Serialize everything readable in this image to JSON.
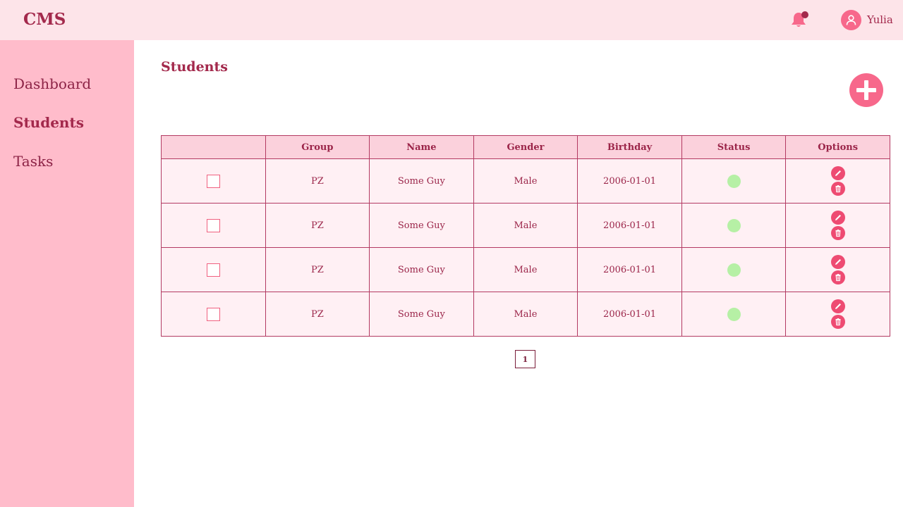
{
  "header": {
    "logo": "CMS",
    "user_name": "Yulia"
  },
  "sidebar": {
    "items": [
      {
        "label": "Dashboard",
        "active": false
      },
      {
        "label": "Students",
        "active": true
      },
      {
        "label": "Tasks",
        "active": false
      }
    ]
  },
  "main": {
    "title": "Students",
    "table": {
      "headers": [
        "",
        "Group",
        "Name",
        "Gender",
        "Birthday",
        "Status",
        "Options"
      ],
      "rows": [
        {
          "group": "PZ",
          "name": "Some Guy",
          "gender": "Male",
          "birthday": "2006-01-01",
          "status": "active"
        },
        {
          "group": "PZ",
          "name": "Some Guy",
          "gender": "Male",
          "birthday": "2006-01-01",
          "status": "active"
        },
        {
          "group": "PZ",
          "name": "Some Guy",
          "gender": "Male",
          "birthday": "2006-01-01",
          "status": "active"
        },
        {
          "group": "PZ",
          "name": "Some Guy",
          "gender": "Male",
          "birthday": "2006-01-01",
          "status": "active"
        }
      ]
    },
    "pagination": {
      "current_page": "1"
    }
  },
  "icons": {
    "notification": "bell-icon",
    "avatar": "user-icon",
    "add": "plus-icon",
    "edit": "pencil-icon",
    "delete": "trash-icon"
  },
  "colors": {
    "header_bg": "#fde4e9",
    "sidebar_bg": "#ffbccb",
    "accent": "#f7688b",
    "text": "#a3294c",
    "status_active": "#b6f0a5"
  }
}
